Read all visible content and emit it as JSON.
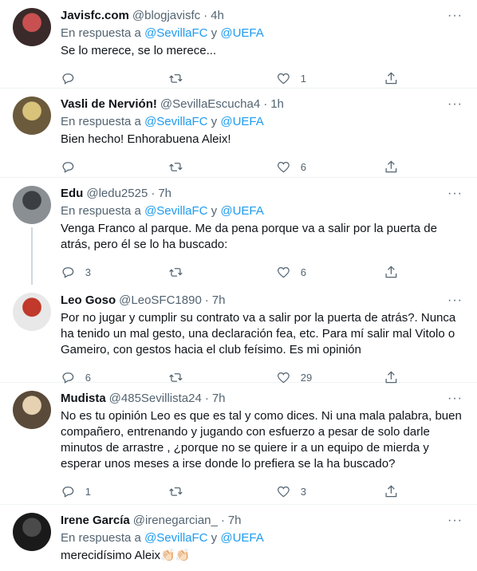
{
  "reply_prefix": "En respuesta a",
  "reply_sep": "y",
  "tweets": [
    {
      "name": "Javisfc.com",
      "handle": "@blogjavisfc",
      "dot": "·",
      "time": "4h",
      "reply_to": [
        "@SevillaFC",
        "@UEFA"
      ],
      "text": "Se lo merece, se lo merece...",
      "replies": "",
      "retweets": "",
      "likes": "1",
      "avatar_colors": [
        "#3a2a2a",
        "#c85050"
      ],
      "threaded": false
    },
    {
      "name": "Vasli de Nervión!",
      "handle": "@SevillaEscucha4",
      "dot": "·",
      "time": "1h",
      "reply_to": [
        "@SevillaFC",
        "@UEFA"
      ],
      "text": "Bien hecho! Enhorabuena Aleix!",
      "replies": "",
      "retweets": "",
      "likes": "6",
      "avatar_colors": [
        "#6b5a3c",
        "#d9c27a"
      ],
      "threaded": false
    },
    {
      "name": "Edu",
      "handle": "@ledu2525",
      "dot": "·",
      "time": "7h",
      "reply_to": [
        "@SevillaFC",
        "@UEFA"
      ],
      "text": "Venga Franco al parque. Me da pena porque va a salir por la puerta de atrás, pero él se lo ha buscado:",
      "replies": "3",
      "retweets": "",
      "likes": "6",
      "avatar_colors": [
        "#8a8f94",
        "#3b3f44"
      ],
      "threaded": true
    },
    {
      "name": "Leo Goso",
      "handle": "@LeoSFC1890",
      "dot": "·",
      "time": "7h",
      "reply_to": [],
      "text": "Por no jugar y cumplir su contrato va a salir por la puerta de atrás?. Nunca ha tenido un mal gesto, una declaración fea, etc. Para mí salir mal Vitolo o Gameiro, con gestos hacia el club feísimo. Es mi opinión",
      "replies": "6",
      "retweets": "",
      "likes": "29",
      "avatar_colors": [
        "#e8e8e8",
        "#c0392b"
      ],
      "threaded": false
    },
    {
      "name": "Mudista",
      "handle": "@485Sevillista24",
      "dot": "·",
      "time": "7h",
      "reply_to": [],
      "text": "No es tu opinión Leo es que es tal y como dices. Ni una mala palabra, buen compañero, entrenando y jugando con esfuerzo a pesar de solo darle minutos de arrastre , ¿porque no se quiere ir a un equipo de mierda y esperar unos meses a irse donde lo prefiera se la ha buscado?",
      "replies": "1",
      "retweets": "",
      "likes": "3",
      "avatar_colors": [
        "#5a4a3a",
        "#e6d2b0"
      ],
      "threaded": false
    },
    {
      "name": "Irene García",
      "handle": "@irenegarcian_",
      "dot": "·",
      "time": "7h",
      "reply_to": [
        "@SevillaFC",
        "@UEFA"
      ],
      "text": "merecidísimo Aleix👏🏻👏🏻",
      "replies": "",
      "retweets": "",
      "likes": "",
      "avatar_colors": [
        "#1a1a1a",
        "#4a4a4a"
      ],
      "threaded": false
    }
  ]
}
